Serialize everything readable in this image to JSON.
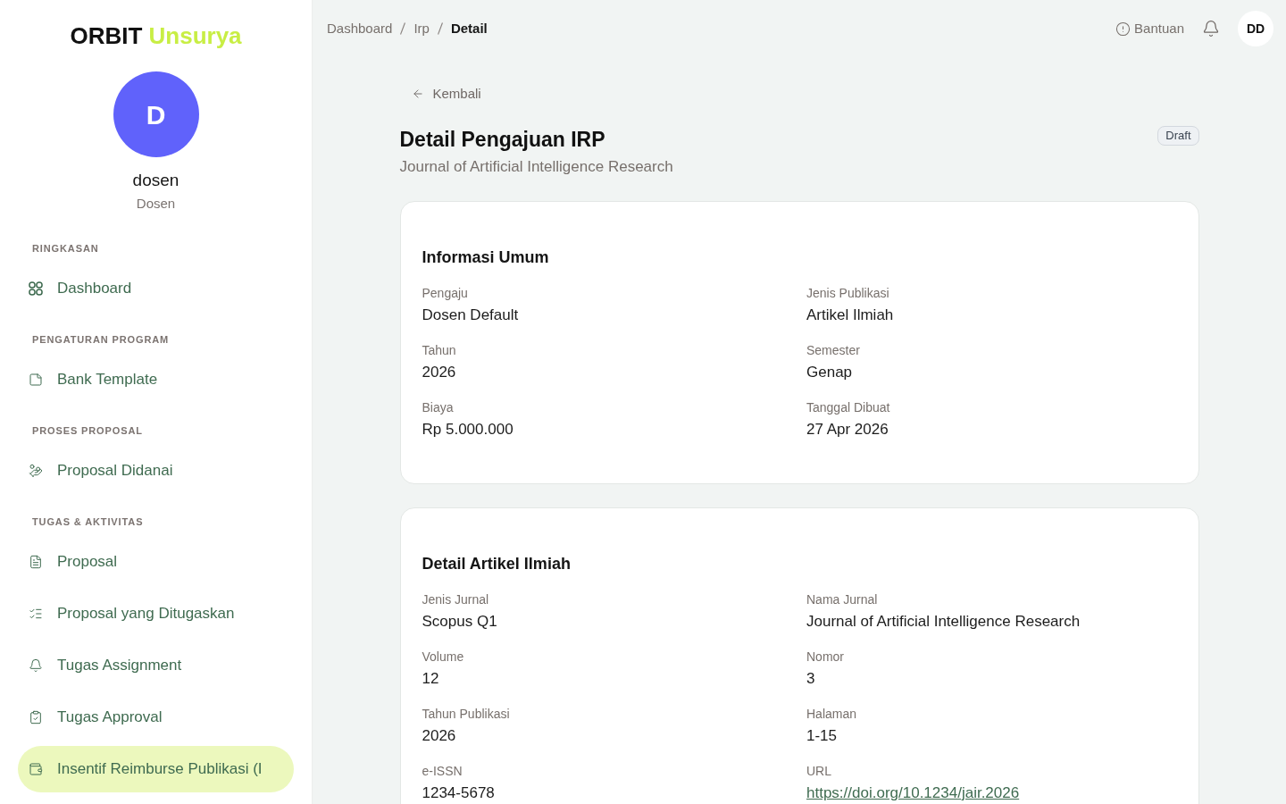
{
  "sidebar": {
    "logo": {
      "primary": "ORBIT",
      "accent": "Unsurya"
    },
    "user": {
      "initial": "D",
      "name": "dosen",
      "role": "Dosen"
    },
    "sections": [
      {
        "title": "RINGKASAN",
        "items": [
          {
            "label": "Dashboard",
            "selected": false
          }
        ]
      },
      {
        "title": "PENGATURAN PROGRAM",
        "items": [
          {
            "label": "Bank Template",
            "selected": false
          }
        ]
      },
      {
        "title": "PROSES PROPOSAL",
        "items": [
          {
            "label": "Proposal Didanai",
            "selected": false
          }
        ]
      },
      {
        "title": "TUGAS & AKTIVITAS",
        "items": [
          {
            "label": "Proposal",
            "selected": false
          },
          {
            "label": "Proposal yang Ditugaskan",
            "selected": false
          },
          {
            "label": "Tugas Assignment",
            "selected": false
          },
          {
            "label": "Tugas Approval",
            "selected": false
          },
          {
            "label": "Insentif Reimburse Publikasi (I",
            "selected": true
          }
        ]
      }
    ]
  },
  "header": {
    "breadcrumb": [
      {
        "label": "Dashboard",
        "current": false
      },
      {
        "label": "Irp",
        "current": false
      },
      {
        "label": "Detail",
        "current": true
      }
    ],
    "help": "Bantuan",
    "avatar": "DD"
  },
  "page": {
    "back": "Kembali",
    "title": "Detail Pengajuan IRP",
    "subtitle": "Journal of Artificial Intelligence Research",
    "status": "Draft"
  },
  "cards": [
    {
      "title": "Informasi Umum",
      "fields": [
        {
          "label": "Pengaju",
          "value": "Dosen Default",
          "kind": "text"
        },
        {
          "label": "Jenis Publikasi",
          "value": "Artikel Ilmiah",
          "kind": "text"
        },
        {
          "label": "Tahun",
          "value": "2026",
          "kind": "text"
        },
        {
          "label": "Semester",
          "value": "Genap",
          "kind": "text"
        },
        {
          "label": "Biaya",
          "value": "Rp 5.000.000",
          "kind": "text"
        },
        {
          "label": "Tanggal Dibuat",
          "value": "27 Apr 2026",
          "kind": "text"
        }
      ]
    },
    {
      "title": "Detail Artikel Ilmiah",
      "fields": [
        {
          "label": "Jenis Jurnal",
          "value": "Scopus Q1",
          "kind": "text"
        },
        {
          "label": "Nama Jurnal",
          "value": "Journal of Artificial Intelligence Research",
          "kind": "text"
        },
        {
          "label": "Volume",
          "value": "12",
          "kind": "text"
        },
        {
          "label": "Nomor",
          "value": "3",
          "kind": "text"
        },
        {
          "label": "Tahun Publikasi",
          "value": "2026",
          "kind": "text"
        },
        {
          "label": "Halaman",
          "value": "1-15",
          "kind": "text"
        },
        {
          "label": "e-ISSN",
          "value": "1234-5678",
          "kind": "text"
        },
        {
          "label": "URL",
          "value": "https://doi.org/10.1234/jair.2026",
          "kind": "link"
        }
      ]
    }
  ]
}
